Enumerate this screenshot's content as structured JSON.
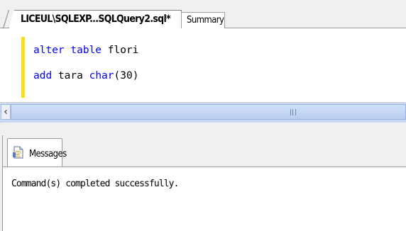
{
  "tabs": [
    {
      "label": "LICEUL\\SQLEXP...SQLQuery2.sql*",
      "active": true
    },
    {
      "label": "Summary",
      "active": false
    }
  ],
  "editor": {
    "lines": [
      {
        "keyword": "alter table",
        "text": " flori"
      },
      {
        "keyword": "add",
        "text": " tara ",
        "keyword2": "char",
        "text2": "(30)"
      }
    ],
    "change_marker_color": "#f7df17",
    "keyword_color": "#0000ff"
  },
  "results": {
    "tab_label": "Messages",
    "tab_icon": "messages-page-icon",
    "message": "Command(s) completed successfully."
  },
  "scrollbar": {
    "left_arrow_icon": "chevron-left-icon",
    "grip_icon": "scroll-grip-icon"
  }
}
